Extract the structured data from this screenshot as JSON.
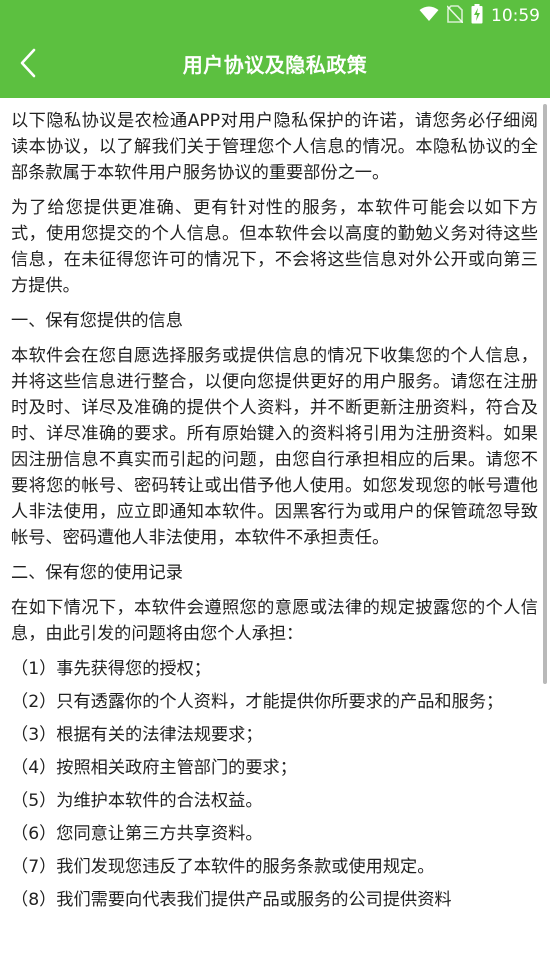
{
  "status_bar": {
    "time": "10:59",
    "icons": [
      "wifi-icon",
      "no-sim-icon",
      "battery-charging-icon"
    ]
  },
  "toolbar": {
    "back_icon": "chevron-left-icon",
    "title": "用户协议及隐私政策"
  },
  "colors": {
    "accent": "#5cc040",
    "text": "#222222"
  },
  "content": {
    "paragraphs": [
      "以下隐私协议是农检通APP对用户隐私保护的许诺，请您务必仔细阅读本协议，以了解我们关于管理您个人信息的情况。本隐私协议的全部条款属于本软件用户服务协议的重要部份之一。",
      "为了给您提供更准确、更有针对性的服务，本软件可能会以如下方式，使用您提交的个人信息。但本软件会以高度的勤勉义务对待这些信息，在未征得您许可的情况下，不会将这些信息对外公开或向第三方提供。",
      "一、保有您提供的信息",
      "本软件会在您自愿选择服务或提供信息的情况下收集您的个人信息，并将这些信息进行整合，以便向您提供更好的用户服务。请您在注册时及时、详尽及准确的提供个人资料，并不断更新注册资料，符合及时、详尽准确的要求。所有原始键入的资料将引用为注册资料。如果因注册信息不真实而引起的问题，由您自行承担相应的后果。请您不要将您的帐号、密码转让或出借予他人使用。如您发现您的帐号遭他人非法使用，应立即通知本软件。因黑客行为或用户的保管疏忽导致帐号、密码遭他人非法使用，本软件不承担责任。",
      "二、保有您的使用记录",
      "在如下情况下，本软件会遵照您的意愿或法律的规定披露您的个人信息，由此引发的问题将由您个人承担："
    ],
    "list_items": [
      "（1）事先获得您的授权；",
      "（2）只有透露你的个人资料，才能提供你所要求的产品和服务；",
      "（3）根据有关的法律法规要求；",
      "（4）按照相关政府主管部门的要求；",
      "（5）为维护本软件的合法权益。",
      "（6）您同意让第三方共享资料。",
      "（7）我们发现您违反了本软件的服务条款或使用规定。",
      "（8）我们需要向代表我们提供产品或服务的公司提供资料"
    ]
  }
}
